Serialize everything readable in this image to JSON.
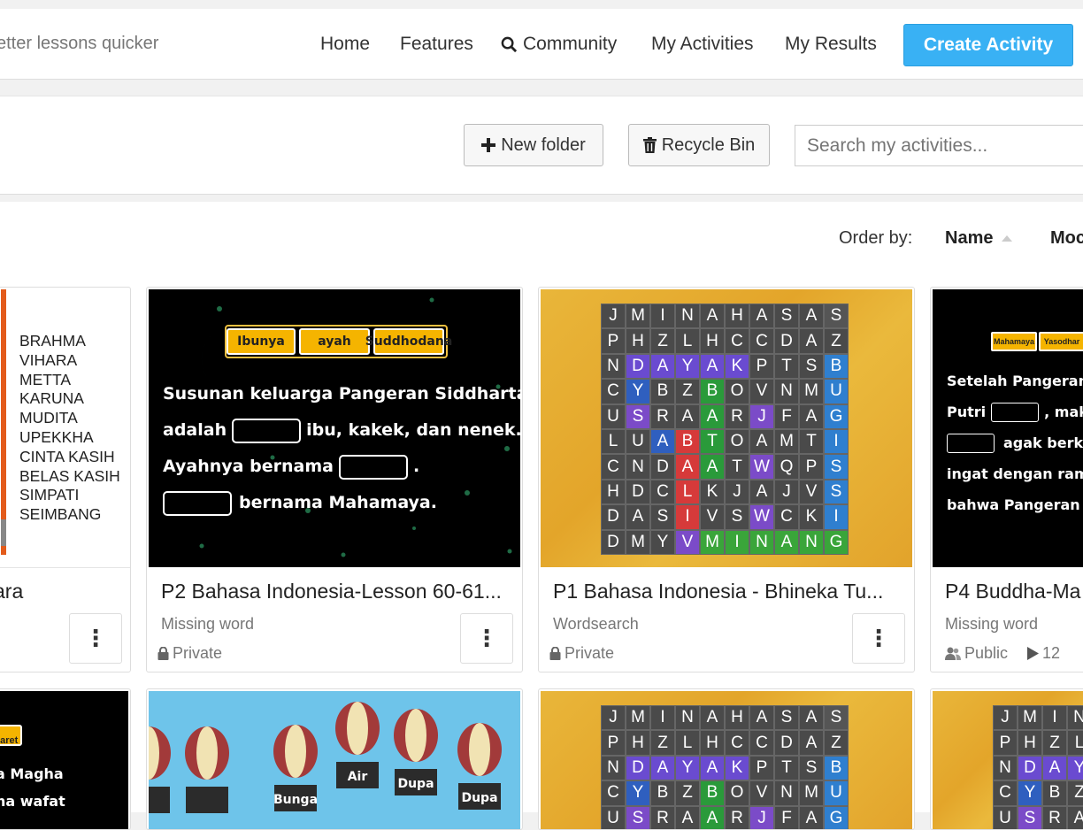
{
  "nav": {
    "tagline": "etter lessons quicker",
    "home": "Home",
    "features": "Features",
    "community": "Community",
    "my_activities": "My Activities",
    "my_results": "My Results",
    "create": "Create Activity"
  },
  "toolbar": {
    "new_folder": "New folder",
    "recycle_bin": "Recycle Bin",
    "search_placeholder": "Search my activities..."
  },
  "order": {
    "label": "Order by:",
    "name": "Name",
    "modified": "Moc"
  },
  "cards": [
    {
      "title": "ara",
      "type": "",
      "visibility": "",
      "words": [
        "BRAHMA",
        "VIHARA",
        "METTA",
        "KARUNA",
        "MUDITA",
        "UPEKKHA",
        "CINTA KASIH",
        "BELAS KASIH",
        "SIMPATI",
        "SEIMBANG"
      ]
    },
    {
      "title": "P2 Bahasa Indonesia-Lesson 60-61...",
      "type": "Missing word",
      "visibility": "Private",
      "boxes": [
        "Ibunya",
        "ayah",
        "Suddhodana"
      ],
      "lines": [
        "Susunan keluarga Pangeran Siddharta",
        "adalah",
        "ibu, kakek, dan nenek.",
        "Ayahnya bernama",
        "bernama Mahamaya."
      ]
    },
    {
      "title": "P1 Bahasa Indonesia - Bhineka Tu...",
      "type": "Wordsearch",
      "visibility": "Private"
    },
    {
      "title": "P4 Buddha-Ma",
      "type": "Missing word",
      "visibility": "Public",
      "plays": "12",
      "boxes": [
        "Mahamaya",
        "Yasodhar"
      ],
      "lines": [
        "Setelah Pangeran S",
        "Putri",
        ", mak",
        "agak berku",
        "ingat dengan rama",
        "bahwa Pangeran k"
      ]
    }
  ],
  "row2": {
    "card1": {
      "box": "-Maret",
      "lines": [
        "a Magha",
        "ha wafat"
      ]
    },
    "card2": {
      "labels": [
        "Bunga",
        "Air",
        "Dupa",
        "Dupa"
      ]
    }
  },
  "wordsearch": [
    "JMINAHASAS",
    "PHZLHCCDAZ",
    "NDAYAKPTSB",
    "CYBZBOVNMU",
    "USRAARJFAG",
    "LUABTOAMTI",
    "CNDAATWQPS",
    "HDCLKJAJVS",
    "DASIVSWCKI",
    "DMYVMINANG"
  ],
  "colors": {
    "accent": "#39b1f4"
  }
}
